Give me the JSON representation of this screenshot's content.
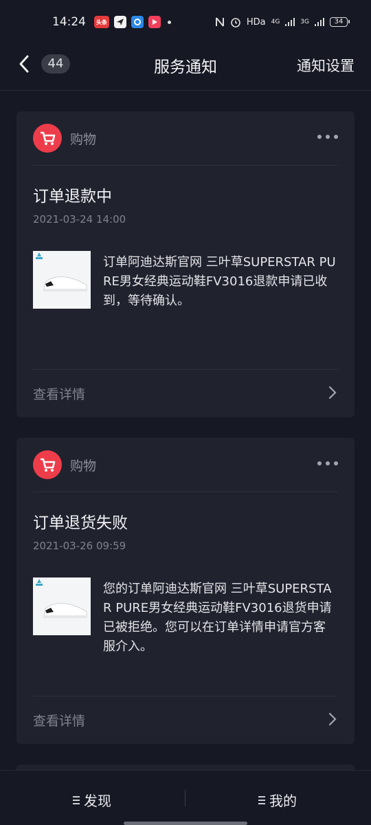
{
  "status_bar": {
    "time": "14:24",
    "app_badge_text": "头条",
    "network_label": "HDa",
    "signal_1": "4G",
    "signal_2": "3G",
    "battery": "34"
  },
  "header": {
    "unread_count": "44",
    "title": "服务通知",
    "settings_label": "通知设置"
  },
  "notifications": [
    {
      "category": "购物",
      "title": "订单退款中",
      "time": "2021-03-24 14:00",
      "body": "订单阿迪达斯官网 三叶草SUPERSTAR PURE男女经典运动鞋FV3016退款申请已收到，等待确认。",
      "detail_label": "查看详情"
    },
    {
      "category": "购物",
      "title": "订单退货失败",
      "time": "2021-03-26 09:59",
      "body": "您的订单阿迪达斯官网 三叶草SUPERSTAR PURE男女经典运动鞋FV3016退货申请已被拒绝。您可以在订单详情申请官方客服介入。",
      "detail_label": "查看详情"
    }
  ],
  "bottom_nav": {
    "discover_label": "发现",
    "mine_label": "我的"
  },
  "colors": {
    "background": "#161823",
    "card": "#20222e",
    "category_icon": "#ee3d4a"
  }
}
